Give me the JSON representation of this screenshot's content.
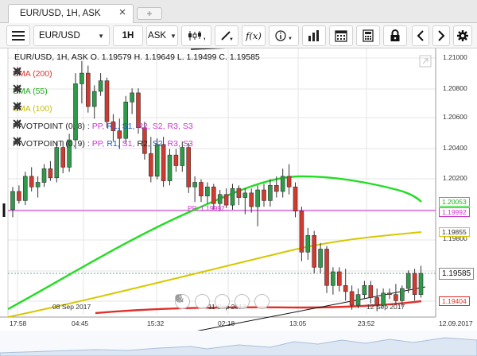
{
  "tab": {
    "title": "EUR/USD, 1H, ASK",
    "close": "×",
    "add": "+"
  },
  "toolbar": {
    "symbol": "EUR/USD",
    "timeframe": "1H",
    "price_side": "ASK",
    "fx_label": "f(x)"
  },
  "chart": {
    "ohlc": "EUR/USD, 1H, ASK   O. 1.19579 H. 1.19649 L. 1.19499 C. 1.19585",
    "indicators": [
      {
        "name": "SMA (200)",
        "color": "#e0302a"
      },
      {
        "name": "SMA (55)",
        "color": "#22bb22"
      },
      {
        "name": "SMA (100)",
        "color": "#d6c800"
      }
    ],
    "pivots": [
      {
        "name": "PIVOTPOINT (0, 8)",
        "sep": ":",
        "tokens": [
          {
            "t": "PP",
            "c": "#cc33cc"
          },
          {
            "t": "R1",
            "c": "#2255cc"
          },
          {
            "t": "S1",
            "c": "#2255cc"
          },
          {
            "t": "R2",
            "c": "#cc33cc"
          },
          {
            "t": "S2",
            "c": "#cc33cc"
          },
          {
            "t": "R3",
            "c": "#cc33cc"
          },
          {
            "t": "S3",
            "c": "#cc33cc"
          }
        ]
      },
      {
        "name": "PIVOTPOINT (0, 9)",
        "sep": ":",
        "tokens": [
          {
            "t": "PP",
            "c": "#cc33cc"
          },
          {
            "t": "R1",
            "c": "#2255cc"
          },
          {
            "t": "S1",
            "c": "#cc33cc"
          },
          {
            "t": "R2",
            "c": "#222222"
          },
          {
            "t": "S2",
            "c": "#2255cc"
          },
          {
            "t": "R3",
            "c": "#cc33cc"
          },
          {
            "t": "S3",
            "c": "#cc33cc"
          }
        ]
      }
    ],
    "pp_label": "PP: 1.19992",
    "date_labels": [
      "08 Sep 2017",
      "11 Sep 2017",
      "12 Sep 2017"
    ],
    "price_tags": [
      {
        "text": "1.20053",
        "color": "#22bb22"
      },
      {
        "text": "1.19992",
        "color": "#cc33cc"
      },
      {
        "text": "1.19855",
        "color": "#d6c800"
      },
      {
        "text": "1.19585",
        "color": "#777777"
      },
      {
        "text": "1.19404",
        "color": "#e0302a"
      }
    ]
  },
  "chart_data": {
    "type": "candlestick",
    "y_ticks": [
      "1.21000",
      "1.20800",
      "1.20600",
      "1.20400",
      "1.20200",
      "1.19800"
    ],
    "ylim": [
      1.19404,
      1.21
    ],
    "x_ticks": [
      "17:58",
      "04:45",
      "15:32",
      "02:18",
      "13:05",
      "23:52",
      "12.09.2017"
    ],
    "candles": [
      [
        1.2,
        1.2015,
        1.1995,
        1.2012
      ],
      [
        1.2012,
        1.2016,
        1.2004,
        1.2006
      ],
      [
        1.2006,
        1.2025,
        1.2003,
        1.2022
      ],
      [
        1.2022,
        1.2028,
        1.2012,
        1.2015
      ],
      [
        1.2015,
        1.2022,
        1.2008,
        1.2018
      ],
      [
        1.2018,
        1.203,
        1.2015,
        1.2027
      ],
      [
        1.2027,
        1.2032,
        1.2019,
        1.2021
      ],
      [
        1.2021,
        1.2045,
        1.2018,
        1.2041
      ],
      [
        1.2041,
        1.2045,
        1.2024,
        1.2028
      ],
      [
        1.2028,
        1.205,
        1.2025,
        1.2046
      ],
      [
        1.2046,
        1.209,
        1.204,
        1.2083
      ],
      [
        1.2083,
        1.2098,
        1.207,
        1.209
      ],
      [
        1.209,
        1.2095,
        1.2064,
        1.2068
      ],
      [
        1.2068,
        1.2082,
        1.206,
        1.2078
      ],
      [
        1.2078,
        1.209,
        1.2075,
        1.2085
      ],
      [
        1.2085,
        1.2087,
        1.2054,
        1.2058
      ],
      [
        1.2058,
        1.2063,
        1.2045,
        1.2052
      ],
      [
        1.2052,
        1.206,
        1.204,
        1.2047
      ],
      [
        1.2047,
        1.2075,
        1.2044,
        1.2071
      ],
      [
        1.2071,
        1.208,
        1.2063,
        1.2077
      ],
      [
        1.2077,
        1.208,
        1.205,
        1.2054
      ],
      [
        1.2054,
        1.2058,
        1.2033,
        1.2037
      ],
      [
        1.2037,
        1.2048,
        1.2018,
        1.2022
      ],
      [
        1.2022,
        1.2047,
        1.202,
        1.2043
      ],
      [
        1.2043,
        1.2048,
        1.2015,
        1.2019
      ],
      [
        1.2019,
        1.204,
        1.2016,
        1.2036
      ],
      [
        1.2036,
        1.204,
        1.2025,
        1.2029
      ],
      [
        1.2029,
        1.2045,
        1.2025,
        1.2041
      ],
      [
        1.2041,
        1.2044,
        1.2011,
        1.2015
      ],
      [
        1.2015,
        1.2022,
        1.2005,
        1.2018
      ],
      [
        1.2018,
        1.202,
        1.2005,
        1.2009
      ],
      [
        1.2009,
        1.2018,
        1.2004,
        1.2015
      ],
      [
        1.2015,
        1.2017,
        1.2,
        1.2004
      ],
      [
        1.2004,
        1.2013,
        1.1999,
        1.201
      ],
      [
        1.201,
        1.2014,
        1.2001,
        1.2003
      ],
      [
        1.2003,
        1.2017,
        1.2,
        1.2014
      ],
      [
        1.2014,
        1.2016,
        1.2003,
        1.2008
      ],
      [
        1.2008,
        1.2014,
        1.1997,
        1.2011
      ],
      [
        1.2011,
        1.2014,
        1.1998,
        1.2002
      ],
      [
        1.2002,
        1.2016,
        1.1989,
        1.2013
      ],
      [
        1.2013,
        1.2017,
        1.2002,
        1.2006
      ],
      [
        1.2006,
        1.202,
        1.2002,
        1.2016
      ],
      [
        1.2016,
        1.2022,
        1.2008,
        1.2012
      ],
      [
        1.2012,
        1.2027,
        1.2008,
        1.2022
      ],
      [
        1.2022,
        1.203,
        1.201,
        1.2015
      ],
      [
        1.2015,
        1.2018,
        1.1995,
        1.1999
      ],
      [
        1.1999,
        1.2002,
        1.1966,
        1.1972
      ],
      [
        1.1972,
        1.1988,
        1.1967,
        1.1983
      ],
      [
        1.1983,
        1.1986,
        1.1958,
        1.1962
      ],
      [
        1.1962,
        1.1978,
        1.1958,
        1.1974
      ],
      [
        1.1974,
        1.1976,
        1.1945,
        1.195
      ],
      [
        1.195,
        1.1962,
        1.1944,
        1.1959
      ],
      [
        1.1959,
        1.1962,
        1.1946,
        1.195
      ],
      [
        1.195,
        1.1961,
        1.194,
        1.1946
      ],
      [
        1.1946,
        1.195,
        1.1934,
        1.1937
      ],
      [
        1.1937,
        1.1948,
        1.1935,
        1.1944
      ],
      [
        1.1944,
        1.1953,
        1.1941,
        1.195
      ],
      [
        1.195,
        1.1953,
        1.1938,
        1.1942
      ],
      [
        1.1942,
        1.1948,
        1.1933,
        1.1937
      ],
      [
        1.1937,
        1.1948,
        1.1936,
        1.1945
      ],
      [
        1.1945,
        1.1948,
        1.1941,
        1.1944
      ],
      [
        1.1944,
        1.1951,
        1.1937,
        1.194
      ],
      [
        1.194,
        1.195,
        1.1936,
        1.1948
      ],
      [
        1.1948,
        1.196,
        1.1945,
        1.1958
      ],
      [
        1.1958,
        1.1961,
        1.194,
        1.1944
      ],
      [
        1.1944,
        1.1963,
        1.1942,
        1.1958
      ]
    ]
  }
}
